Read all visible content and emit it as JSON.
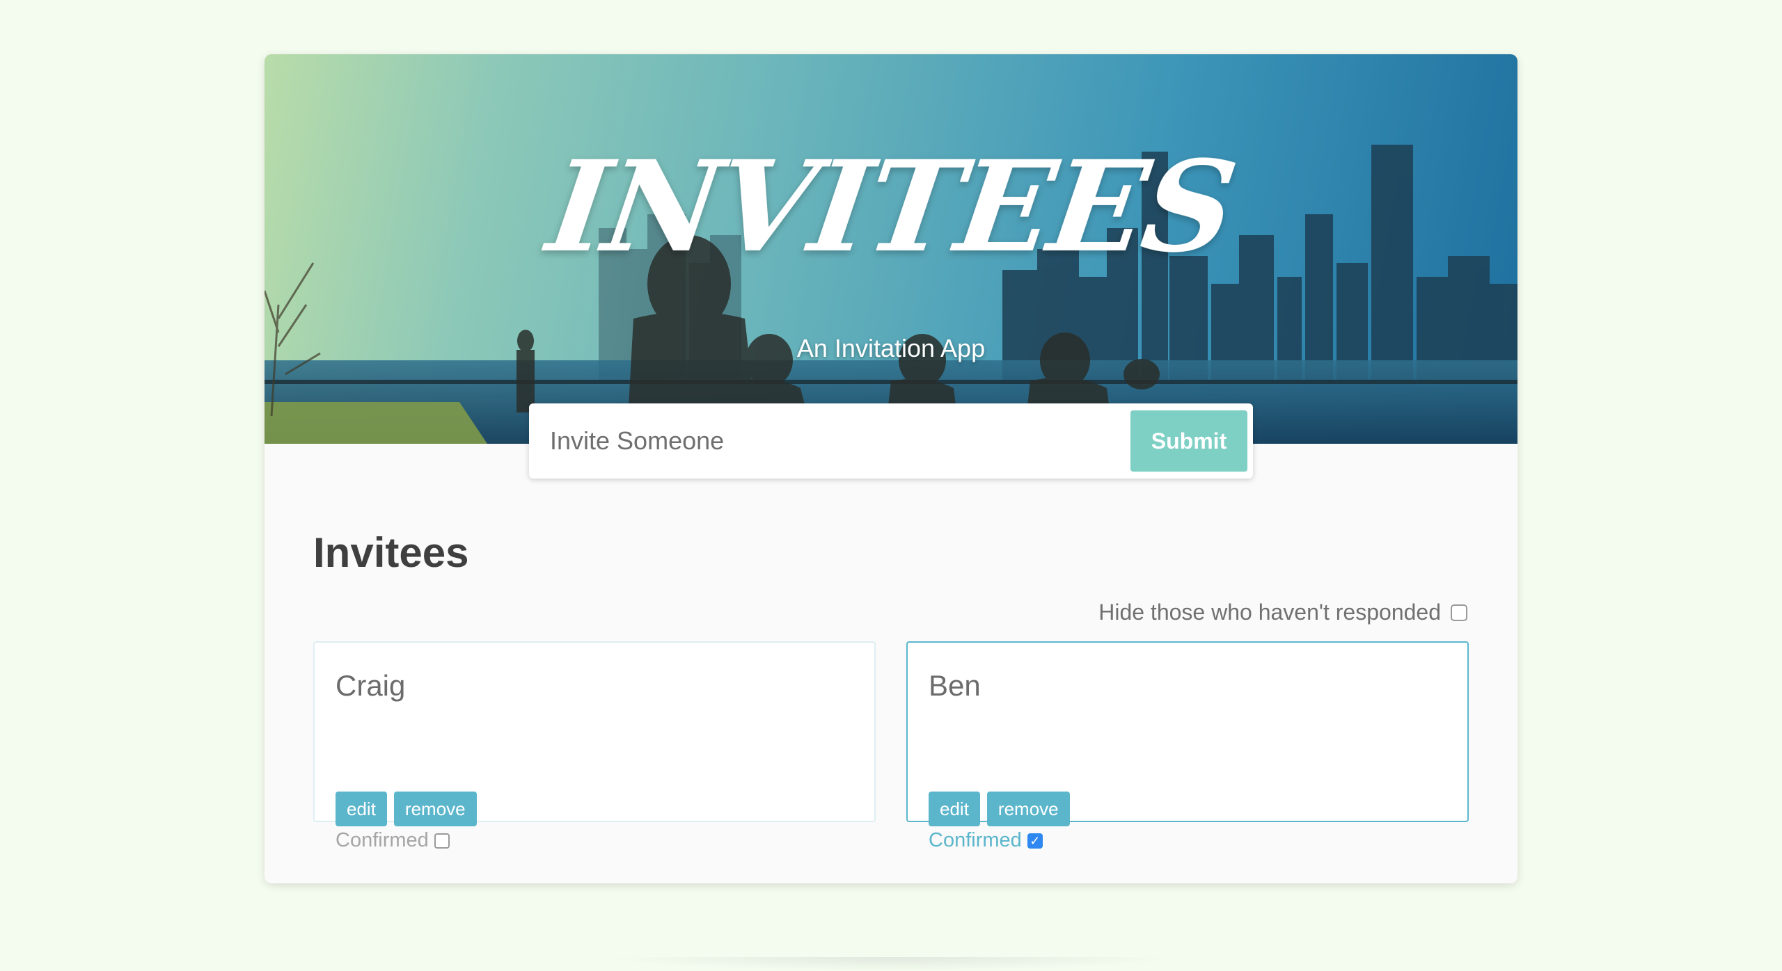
{
  "hero": {
    "title": "INVITEES",
    "subtitle": "An Invitation App"
  },
  "form": {
    "placeholder": "Invite Someone",
    "submit_label": "Submit"
  },
  "list": {
    "title": "Invitees",
    "filter_label": "Hide those who haven't responded",
    "filter_checked": false
  },
  "invitees": [
    {
      "name": "Craig",
      "edit_label": "edit",
      "remove_label": "remove",
      "confirm_label": "Confirmed",
      "confirmed": false
    },
    {
      "name": "Ben",
      "edit_label": "edit",
      "remove_label": "remove",
      "confirm_label": "Confirmed",
      "confirmed": true
    }
  ],
  "colors": {
    "accent": "#5bb6cc",
    "submit": "#7ecfc4",
    "background": "#f4fbef",
    "checkbox_checked": "#2e88f0"
  }
}
